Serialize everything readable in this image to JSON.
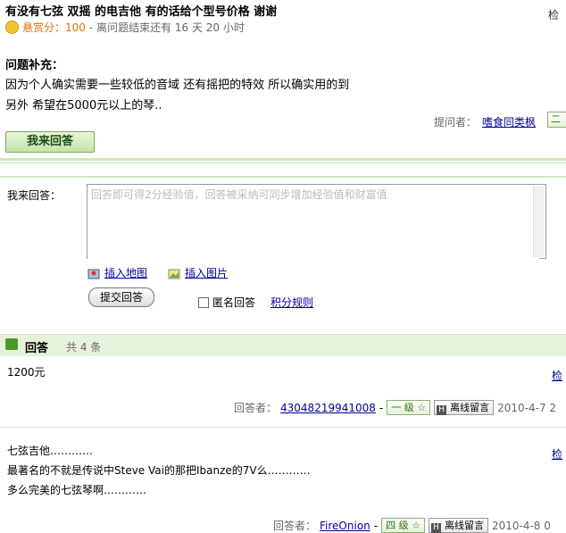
{
  "question": {
    "title": "有没有七弦  双摇  的电吉他  有的话给个型号价格  谢谢",
    "report_link": "检",
    "bounty_label": "悬赏分：",
    "bounty_value": "100",
    "time_left": "- 离问题结束还有  16 天  20 小时",
    "supplement_title": "问题补充：",
    "supplement_lines": [
      "因为个人确实需要一些较低的音域  还有摇把的特效  所以确实用的到",
      "另外  希望在5000元以上的琴.."
    ],
    "asker_label": "提问者：",
    "asker_name": "嗜食同类枫",
    "asker_level": "二"
  },
  "answer_button_label": "我来回答",
  "answer_form": {
    "label": "我来回答：",
    "placeholder": "回答即可得2分经验值，回答被采纳可同步增加经验值和财富值",
    "insert_map": "插入地图",
    "insert_image": "插入图片",
    "submit": "提交回答",
    "anonymous": "匿名回答",
    "points_rules": "积分规则"
  },
  "answers_section": {
    "title": "回答",
    "count": "共  4 条",
    "items": [
      {
        "lines": [
          "1200元"
        ],
        "check": "检",
        "responder_label": "回答者：",
        "responder_name": "43048219941008",
        "level": "一  级",
        "offline_msg": "离线留言",
        "date": "2010-4-7 2"
      },
      {
        "lines": [
          "七弦吉他…………",
          "最著名的不就是传说中Steve Vai的那把Ibanze的7V么…………",
          "多么完美的七弦琴啊…………"
        ],
        "check": "检",
        "responder_label": "回答者：",
        "responder_name": "FireOnion",
        "level": "四  级",
        "offline_msg": "离线留言",
        "date": "2010-4-8 0"
      }
    ]
  },
  "colors": {
    "accent_green": "#cfe6bf",
    "link_blue": "#000099",
    "bounty_orange": "#e07000"
  }
}
